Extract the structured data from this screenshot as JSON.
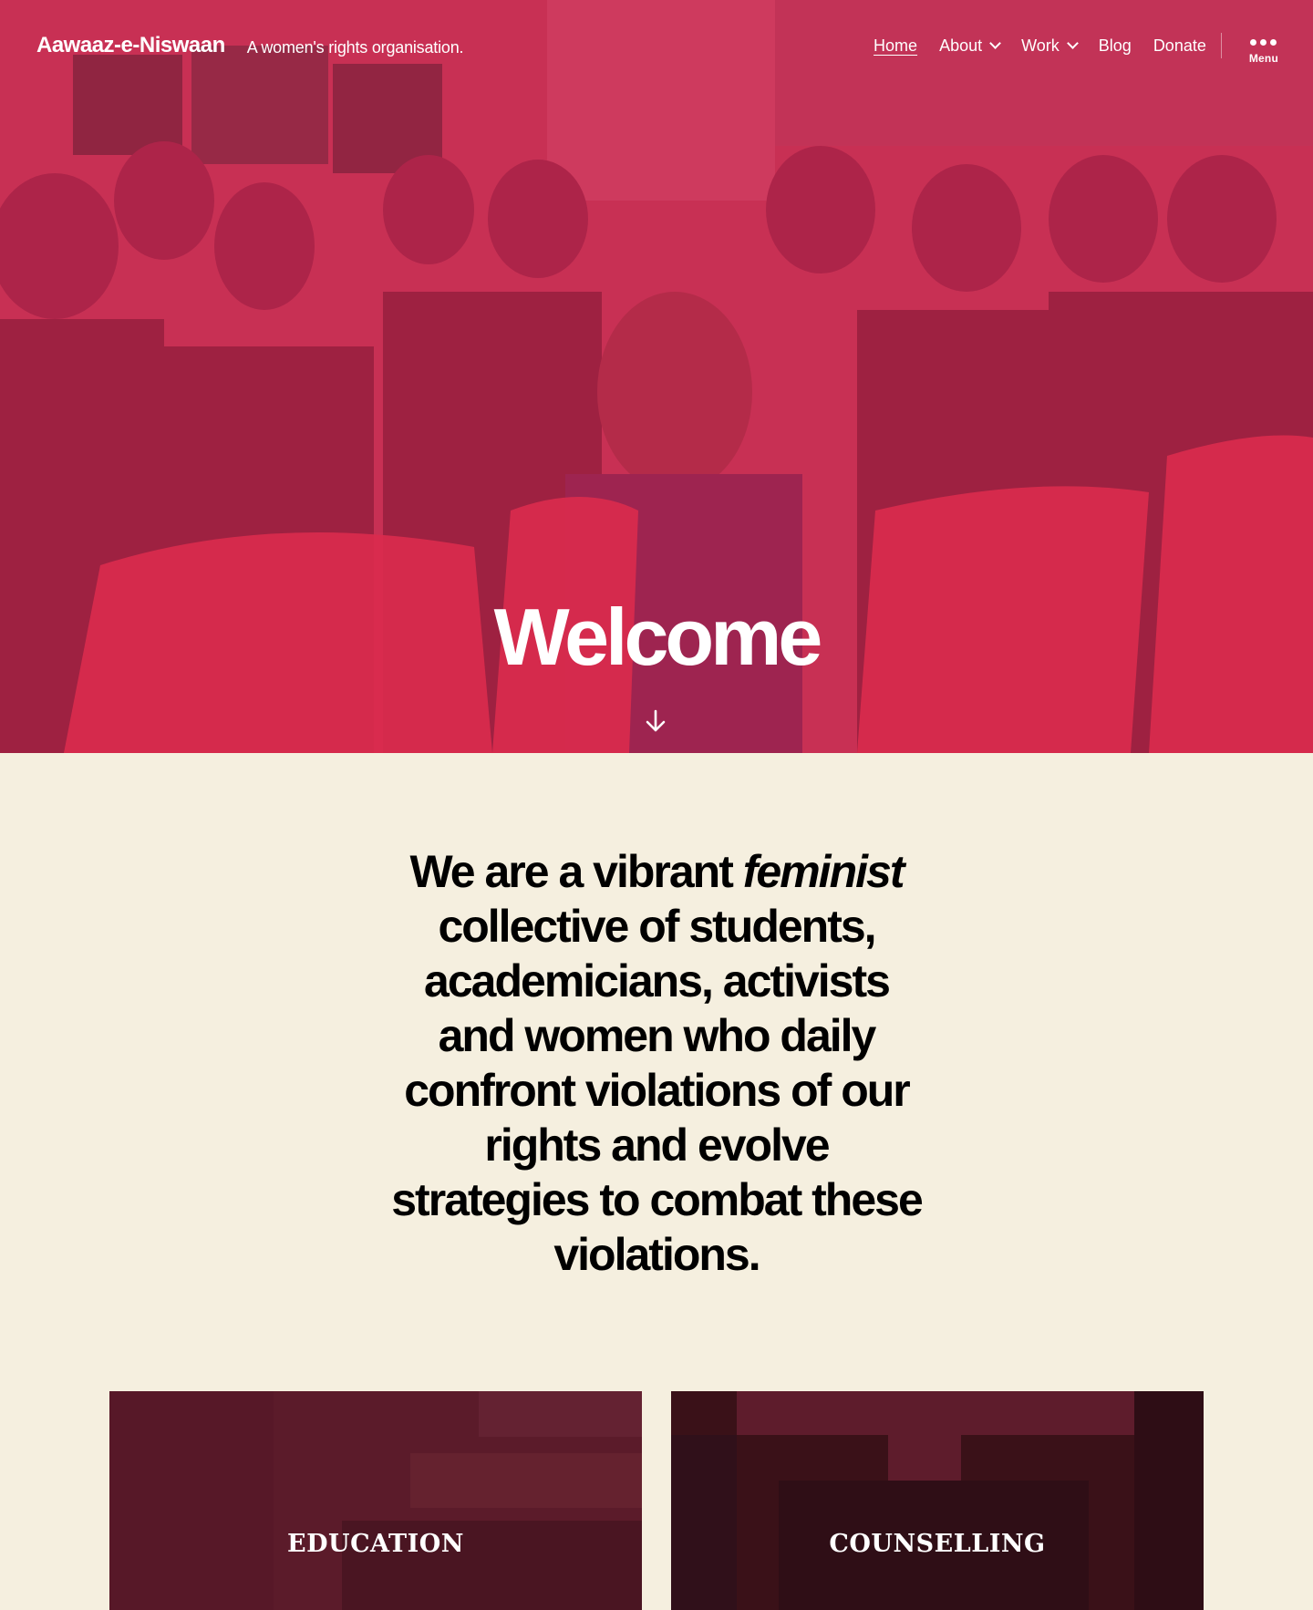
{
  "header": {
    "site_title": "Aawaaz-e-Niswaan",
    "tagline": "A women's rights organisation.",
    "nav": [
      {
        "label": "Home",
        "current": true
      },
      {
        "label": "About",
        "has_submenu": true
      },
      {
        "label": "Work",
        "has_submenu": true
      },
      {
        "label": "Blog"
      },
      {
        "label": "Donate"
      }
    ],
    "menu_label": "Menu"
  },
  "hero": {
    "title": "Welcome",
    "overlay_color": "#d72850",
    "scroll_icon": "arrow-down-icon"
  },
  "intro": {
    "text_before": "We are a vibrant ",
    "text_emphasis": "feminist",
    "text_after": " collective of students, academicians, activists and women who daily confront violations of our rights and evolve strategies to combat these violations."
  },
  "cards": [
    {
      "label": "EDUCATION",
      "color": "#5b1b2a"
    },
    {
      "label": "COUNSELLING",
      "color": "#3a1118"
    }
  ],
  "colors": {
    "background": "#f5efdf",
    "text": "#000000",
    "accent": "#d72850"
  }
}
